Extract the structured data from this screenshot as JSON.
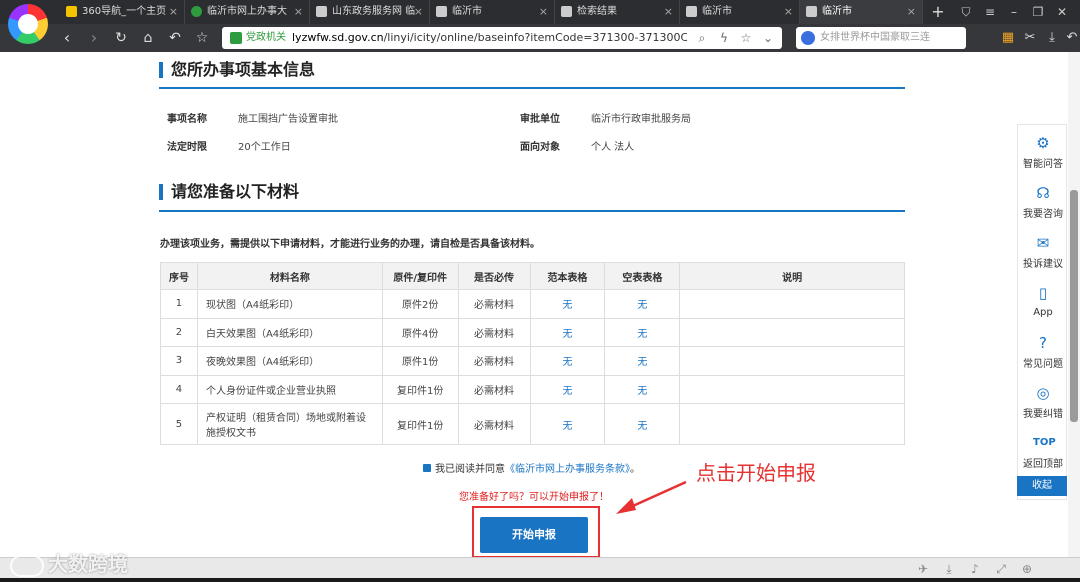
{
  "browser": {
    "tabs": [
      {
        "label": "360导航_一个主页",
        "active": false
      },
      {
        "label": "临沂市网上办事大",
        "active": false
      },
      {
        "label": "山东政务服务网 临",
        "active": false
      },
      {
        "label": "临沂市",
        "active": false
      },
      {
        "label": "检索结果",
        "active": false
      },
      {
        "label": "临沂市",
        "active": false
      },
      {
        "label": "临沂市",
        "active": true
      }
    ],
    "new_tab": "+",
    "address": {
      "badge": "党政机关",
      "host": "lyzwfw.sd.gov.cn",
      "path": "/linyi/icity/online/baseinfo?itemCode=371300-371300CC"
    },
    "search_placeholder": "女排世界杯中国豪取三连"
  },
  "basic_info": {
    "title": "您所办事项基本信息",
    "fields": [
      {
        "label": "事项名称",
        "value": "施工围挡广告设置审批"
      },
      {
        "label": "审批单位",
        "value": "临沂市行政审批服务局"
      },
      {
        "label": "法定时限",
        "value": "20个工作日"
      },
      {
        "label": "面向对象",
        "value": "个人 法人"
      }
    ]
  },
  "materials": {
    "title": "请您准备以下材料",
    "notice": "办理该项业务，需提供以下申请材料，才能进行业务的办理，请自检是否具备该材料。",
    "headers": [
      "序号",
      "材料名称",
      "原件/复印件",
      "是否必传",
      "范本表格",
      "空表表格",
      "说明"
    ],
    "rows": [
      {
        "no": "1",
        "name": "现状图（A4纸彩印）",
        "copy": "原件2份",
        "required": "必需材料",
        "sample": "无",
        "blank": "无",
        "note": ""
      },
      {
        "no": "2",
        "name": "白天效果图（A4纸彩印）",
        "copy": "原件4份",
        "required": "必需材料",
        "sample": "无",
        "blank": "无",
        "note": ""
      },
      {
        "no": "3",
        "name": "夜晚效果图（A4纸彩印）",
        "copy": "原件1份",
        "required": "必需材料",
        "sample": "无",
        "blank": "无",
        "note": ""
      },
      {
        "no": "4",
        "name": "个人身份证件或企业营业执照",
        "copy": "复印件1份",
        "required": "必需材料",
        "sample": "无",
        "blank": "无",
        "note": ""
      },
      {
        "no": "5",
        "name": "产权证明（租赁合同）场地或附着设施授权文书",
        "copy": "复印件1份",
        "required": "必需材料",
        "sample": "无",
        "blank": "无",
        "note": ""
      }
    ]
  },
  "agreement": {
    "prefix": "我已阅读并同意",
    "link": "《临沂市网上办事服务条款》",
    "suffix": "。"
  },
  "ready_text": "您准备好了吗？可以开始申报了！",
  "start_button": "开始申报",
  "annotation": "点击开始申报",
  "float_bar": {
    "items": [
      {
        "label": "智能问答",
        "icon": "robot-icon"
      },
      {
        "label": "我要咨询",
        "icon": "headset-icon"
      },
      {
        "label": "投诉建议",
        "icon": "message-icon"
      },
      {
        "label": "App",
        "icon": "phone-icon"
      },
      {
        "label": "常见问题",
        "icon": "question-icon"
      },
      {
        "label": "我要纠错",
        "icon": "location-icon"
      },
      {
        "label": "返回顶部",
        "icon": "top-icon"
      }
    ],
    "collapse": "收起"
  },
  "watermark": "大数跨境",
  "colors": {
    "accent": "#1a74c4",
    "alert": "#e63232"
  }
}
